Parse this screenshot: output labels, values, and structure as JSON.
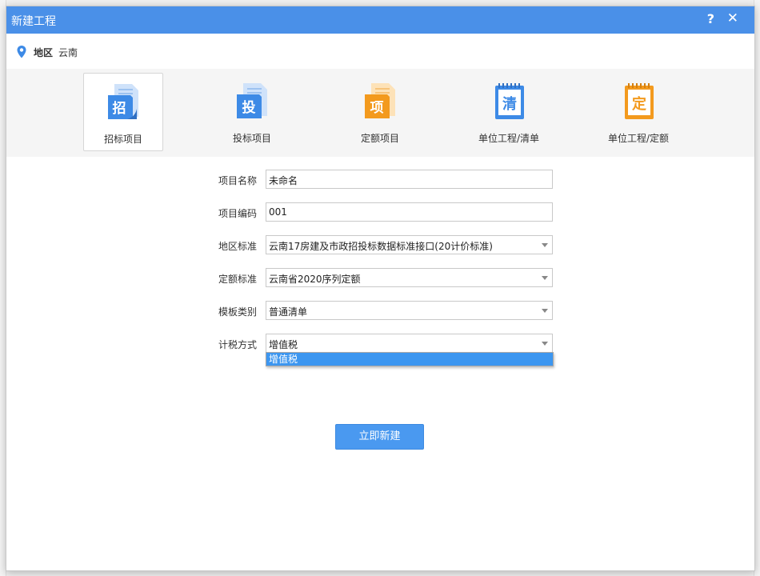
{
  "dialog": {
    "title": "新建工程",
    "help_glyph": "?",
    "close_glyph": "✕"
  },
  "region": {
    "label": "地区",
    "value": "云南"
  },
  "project_types": [
    {
      "caption": "招标项目",
      "glyph": "招",
      "color": "#3d8ae6",
      "icon": "bid-document-icon"
    },
    {
      "caption": "投标项目",
      "glyph": "投",
      "color": "#3d8ae6",
      "icon": "tender-document-icon"
    },
    {
      "caption": "定额项目",
      "glyph": "项",
      "color": "#f39a1e",
      "icon": "quota-project-icon"
    },
    {
      "caption": "单位工程/清单",
      "glyph": "清",
      "color": "#3d8ae6",
      "icon": "notebook-icon"
    },
    {
      "caption": "单位工程/定额",
      "glyph": "定",
      "color": "#f39a1e",
      "icon": "notebook-icon"
    }
  ],
  "form": {
    "project_name": {
      "label": "项目名称",
      "value": "未命名"
    },
    "project_code": {
      "label": "项目编码",
      "value": "001"
    },
    "region_standard": {
      "label": "地区标准",
      "value": "云南17房建及市政招投标数据标准接口(20计价标准)"
    },
    "quota_standard": {
      "label": "定额标准",
      "value": "云南省2020序列定额"
    },
    "template_type": {
      "label": "模板类别",
      "value": "普通清单"
    },
    "tax_method": {
      "label": "计税方式",
      "value": "增值税",
      "options": [
        "增值税"
      ]
    }
  },
  "create_button": "立即新建",
  "colors": {
    "titlebar": "#4a90e8",
    "accent": "#4a99f0",
    "dropdown_highlight": "#3c96f0"
  }
}
